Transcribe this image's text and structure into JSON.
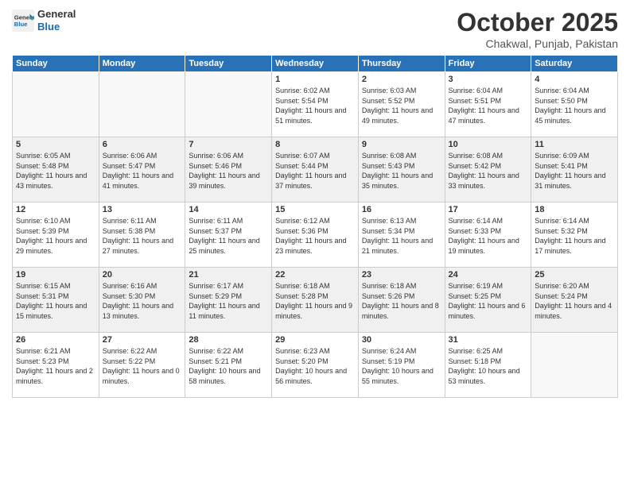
{
  "logo": {
    "line1": "General",
    "line2": "Blue"
  },
  "title": "October 2025",
  "location": "Chakwal, Punjab, Pakistan",
  "days_of_week": [
    "Sunday",
    "Monday",
    "Tuesday",
    "Wednesday",
    "Thursday",
    "Friday",
    "Saturday"
  ],
  "weeks": [
    [
      {
        "day": "",
        "empty": true
      },
      {
        "day": "",
        "empty": true
      },
      {
        "day": "",
        "empty": true
      },
      {
        "day": "1",
        "sunrise": "6:02 AM",
        "sunset": "5:54 PM",
        "daylight": "11 hours and 51 minutes."
      },
      {
        "day": "2",
        "sunrise": "6:03 AM",
        "sunset": "5:52 PM",
        "daylight": "11 hours and 49 minutes."
      },
      {
        "day": "3",
        "sunrise": "6:04 AM",
        "sunset": "5:51 PM",
        "daylight": "11 hours and 47 minutes."
      },
      {
        "day": "4",
        "sunrise": "6:04 AM",
        "sunset": "5:50 PM",
        "daylight": "11 hours and 45 minutes."
      }
    ],
    [
      {
        "day": "5",
        "sunrise": "6:05 AM",
        "sunset": "5:48 PM",
        "daylight": "11 hours and 43 minutes."
      },
      {
        "day": "6",
        "sunrise": "6:06 AM",
        "sunset": "5:47 PM",
        "daylight": "11 hours and 41 minutes."
      },
      {
        "day": "7",
        "sunrise": "6:06 AM",
        "sunset": "5:46 PM",
        "daylight": "11 hours and 39 minutes."
      },
      {
        "day": "8",
        "sunrise": "6:07 AM",
        "sunset": "5:44 PM",
        "daylight": "11 hours and 37 minutes."
      },
      {
        "day": "9",
        "sunrise": "6:08 AM",
        "sunset": "5:43 PM",
        "daylight": "11 hours and 35 minutes."
      },
      {
        "day": "10",
        "sunrise": "6:08 AM",
        "sunset": "5:42 PM",
        "daylight": "11 hours and 33 minutes."
      },
      {
        "day": "11",
        "sunrise": "6:09 AM",
        "sunset": "5:41 PM",
        "daylight": "11 hours and 31 minutes."
      }
    ],
    [
      {
        "day": "12",
        "sunrise": "6:10 AM",
        "sunset": "5:39 PM",
        "daylight": "11 hours and 29 minutes."
      },
      {
        "day": "13",
        "sunrise": "6:11 AM",
        "sunset": "5:38 PM",
        "daylight": "11 hours and 27 minutes."
      },
      {
        "day": "14",
        "sunrise": "6:11 AM",
        "sunset": "5:37 PM",
        "daylight": "11 hours and 25 minutes."
      },
      {
        "day": "15",
        "sunrise": "6:12 AM",
        "sunset": "5:36 PM",
        "daylight": "11 hours and 23 minutes."
      },
      {
        "day": "16",
        "sunrise": "6:13 AM",
        "sunset": "5:34 PM",
        "daylight": "11 hours and 21 minutes."
      },
      {
        "day": "17",
        "sunrise": "6:14 AM",
        "sunset": "5:33 PM",
        "daylight": "11 hours and 19 minutes."
      },
      {
        "day": "18",
        "sunrise": "6:14 AM",
        "sunset": "5:32 PM",
        "daylight": "11 hours and 17 minutes."
      }
    ],
    [
      {
        "day": "19",
        "sunrise": "6:15 AM",
        "sunset": "5:31 PM",
        "daylight": "11 hours and 15 minutes."
      },
      {
        "day": "20",
        "sunrise": "6:16 AM",
        "sunset": "5:30 PM",
        "daylight": "11 hours and 13 minutes."
      },
      {
        "day": "21",
        "sunrise": "6:17 AM",
        "sunset": "5:29 PM",
        "daylight": "11 hours and 11 minutes."
      },
      {
        "day": "22",
        "sunrise": "6:18 AM",
        "sunset": "5:28 PM",
        "daylight": "11 hours and 9 minutes."
      },
      {
        "day": "23",
        "sunrise": "6:18 AM",
        "sunset": "5:26 PM",
        "daylight": "11 hours and 8 minutes."
      },
      {
        "day": "24",
        "sunrise": "6:19 AM",
        "sunset": "5:25 PM",
        "daylight": "11 hours and 6 minutes."
      },
      {
        "day": "25",
        "sunrise": "6:20 AM",
        "sunset": "5:24 PM",
        "daylight": "11 hours and 4 minutes."
      }
    ],
    [
      {
        "day": "26",
        "sunrise": "6:21 AM",
        "sunset": "5:23 PM",
        "daylight": "11 hours and 2 minutes."
      },
      {
        "day": "27",
        "sunrise": "6:22 AM",
        "sunset": "5:22 PM",
        "daylight": "11 hours and 0 minutes."
      },
      {
        "day": "28",
        "sunrise": "6:22 AM",
        "sunset": "5:21 PM",
        "daylight": "10 hours and 58 minutes."
      },
      {
        "day": "29",
        "sunrise": "6:23 AM",
        "sunset": "5:20 PM",
        "daylight": "10 hours and 56 minutes."
      },
      {
        "day": "30",
        "sunrise": "6:24 AM",
        "sunset": "5:19 PM",
        "daylight": "10 hours and 55 minutes."
      },
      {
        "day": "31",
        "sunrise": "6:25 AM",
        "sunset": "5:18 PM",
        "daylight": "10 hours and 53 minutes."
      },
      {
        "day": "",
        "empty": true
      }
    ]
  ]
}
